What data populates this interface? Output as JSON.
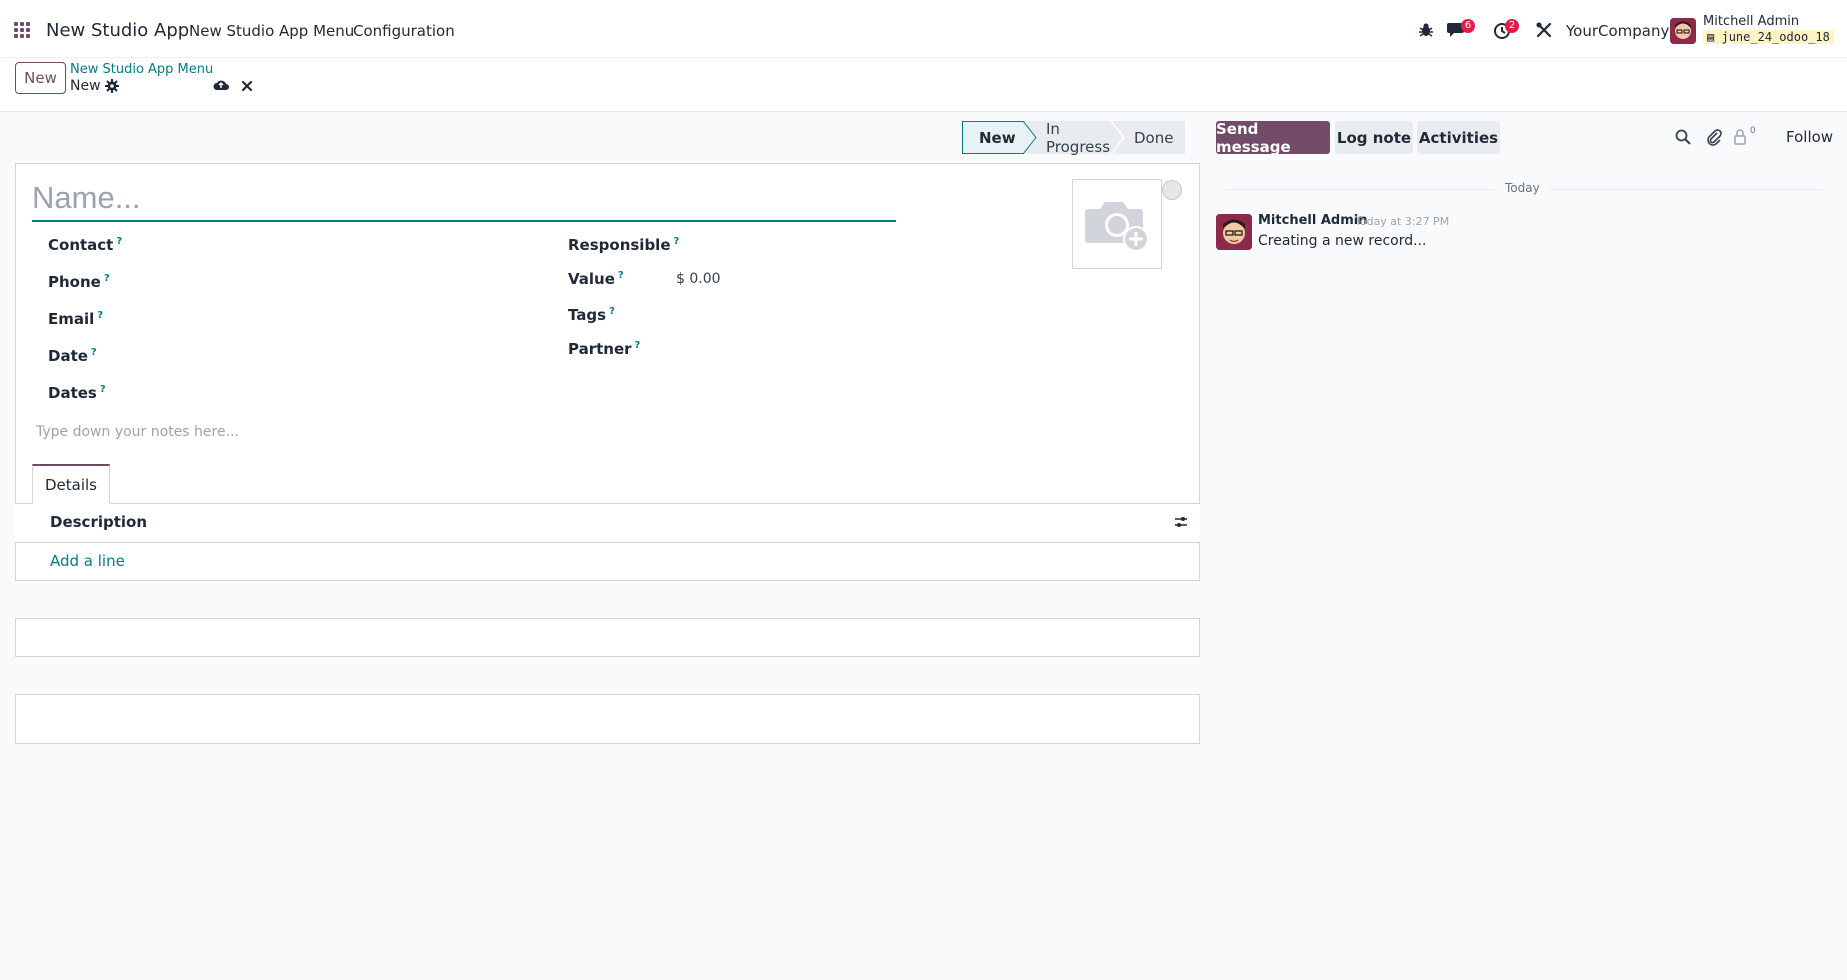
{
  "topnav": {
    "app_title": "New Studio App",
    "menu_items": [
      "New Studio App Menu",
      "Configuration"
    ],
    "messages_badge": "6",
    "activities_badge": "2",
    "company": "YourCompany",
    "user_name": "Mitchell Admin",
    "db_name": "june_24_odoo_18"
  },
  "control": {
    "new_button": "New",
    "breadcrumb_parent": "New Studio App Menu",
    "breadcrumb_current": "New"
  },
  "statusbar": {
    "stages": [
      "New",
      "In Progress",
      "Done"
    ],
    "active": "New"
  },
  "chatter": {
    "send_message": "Send message",
    "log_note": "Log note",
    "activities": "Activities",
    "followers_count": "0",
    "follow": "Follow",
    "date_separator": "Today",
    "message": {
      "author": "Mitchell Admin",
      "time": "Today at 3:27 PM",
      "body": "Creating a new record..."
    }
  },
  "form": {
    "name_placeholder": "Name...",
    "left_fields": [
      {
        "label": "Contact",
        "help": "?"
      },
      {
        "label": "Phone",
        "help": "?"
      },
      {
        "label": "Email",
        "help": "?"
      },
      {
        "label": "Date",
        "help": "?"
      },
      {
        "label": "Dates",
        "help": "?"
      }
    ],
    "right_fields": [
      {
        "label": "Responsible",
        "help": "?",
        "value": ""
      },
      {
        "label": "Value",
        "help": "?",
        "value": "$ 0.00"
      },
      {
        "label": "Tags",
        "help": "?",
        "value": ""
      },
      {
        "label": "Partner",
        "help": "?",
        "value": ""
      }
    ],
    "notes_placeholder": "Type down your notes here...",
    "tab": "Details",
    "table_header": "Description",
    "add_line": "Add a line"
  },
  "colors": {
    "brand": "#714B67",
    "accent": "#017e84",
    "badge": "#e11d48"
  }
}
